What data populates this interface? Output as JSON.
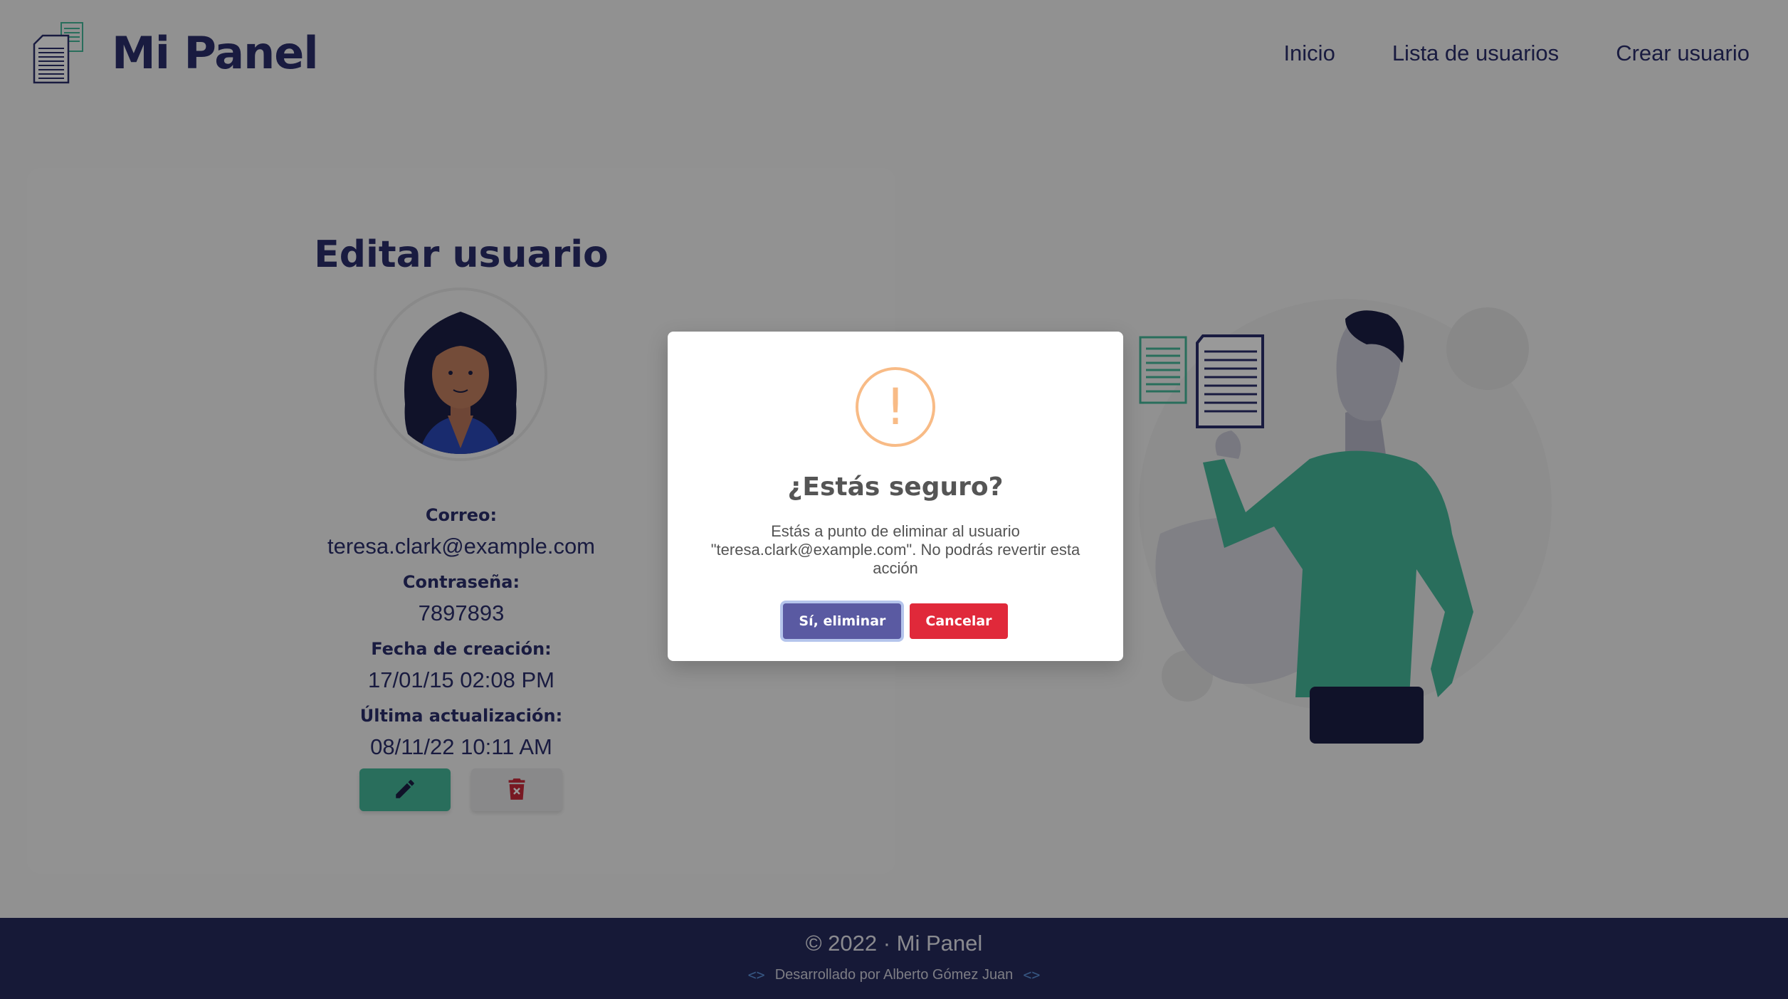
{
  "header": {
    "brand": "Mi Panel",
    "logo_icon": "documents-icon",
    "nav": [
      {
        "label": "Inicio"
      },
      {
        "label": "Lista de usuarios"
      },
      {
        "label": "Crear usuario"
      }
    ]
  },
  "card": {
    "title": "Editar usuario",
    "avatar_icon": "user-avatar",
    "fields": [
      {
        "label": "Correo:",
        "value": "teresa.clark@example.com"
      },
      {
        "label": "Contraseña:",
        "value": "7897893"
      },
      {
        "label": "Fecha de creación:",
        "value": "17/01/15 02:08 PM"
      },
      {
        "label": "Última actualización:",
        "value": "08/11/22 10:11 AM"
      }
    ],
    "edit_icon": "pencil-icon",
    "delete_icon": "trash-icon"
  },
  "footer": {
    "copyright": "© 2022 · Mi Panel",
    "credit": "Desarrollado por Alberto Gómez Juan"
  },
  "modal": {
    "icon": "warning-icon",
    "icon_glyph": "!",
    "title": "¿Estás seguro?",
    "text": "Estás a punto de eliminar al usuario \"teresa.clark@example.com\". No podrás revertir esta acción",
    "confirm_label": "Sí, eliminar",
    "cancel_label": "Cancelar"
  },
  "colors": {
    "brand": "#2a2e6b",
    "accent": "#45b79a",
    "danger": "#e0293a",
    "confirm": "#5a5aa2",
    "warning": "#f8bb86"
  }
}
